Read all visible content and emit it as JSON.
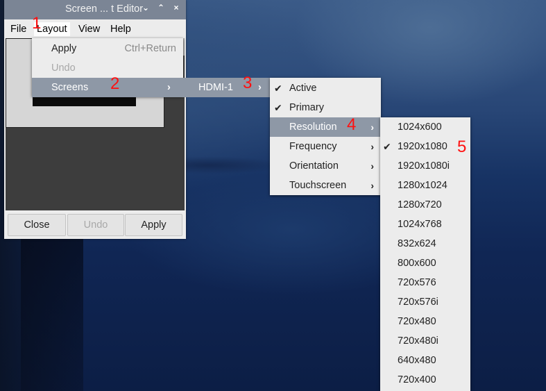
{
  "window": {
    "title": "Screen ... t Editor",
    "controls": [
      "⌄",
      "⌃",
      "×"
    ]
  },
  "menubar": [
    "File",
    "Layout",
    "View",
    "Help"
  ],
  "layout_menu": {
    "apply": "Apply",
    "apply_shortcut": "Ctrl+Return",
    "undo": "Undo",
    "screens": "Screens"
  },
  "screens_submenu": {
    "hdmi": "HDMI-1"
  },
  "hdmi_menu": {
    "active": "Active",
    "primary": "Primary",
    "resolution": "Resolution",
    "frequency": "Frequency",
    "orientation": "Orientation",
    "touchscreen": "Touchscreen"
  },
  "resolutions": [
    "1024x600",
    "1920x1080",
    "1920x1080i",
    "1280x1024",
    "1280x720",
    "1024x768",
    "832x624",
    "800x600",
    "720x576",
    "720x576i",
    "720x480",
    "720x480i",
    "640x480",
    "720x400"
  ],
  "selected_resolution": "1920x1080",
  "buttons": {
    "close": "Close",
    "undo": "Undo",
    "apply": "Apply"
  },
  "glyphs": {
    "check": "✔",
    "arrow": "›"
  },
  "annotations": [
    "1",
    "2",
    "3",
    "4",
    "5"
  ]
}
